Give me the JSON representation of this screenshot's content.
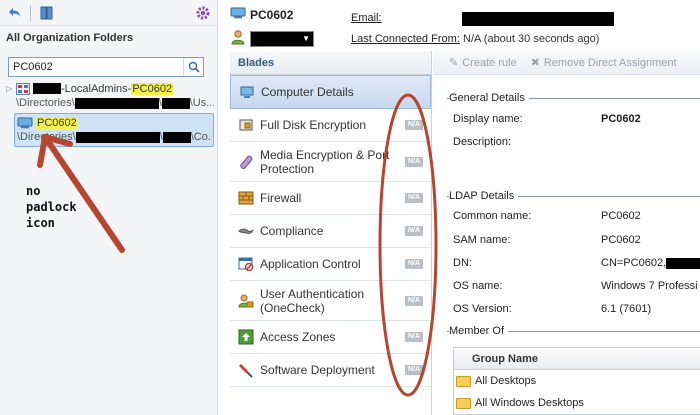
{
  "tree": {
    "title": "All Organization Folders",
    "search_value": "PC0602",
    "items": [
      {
        "row1_suffix": "-LocalAdmins-",
        "row1_hl": "PC0602",
        "row2_prefix": "\\Directories\\",
        "row2_mid": "\\",
        "row2_suffix": "\\Us..."
      },
      {
        "row1_hl": "PC0602",
        "row2_prefix": "\\Directories\\",
        "row2_mid": "\\",
        "row2_suffix": "\\Co..."
      }
    ]
  },
  "annotation": {
    "lines": [
      "no",
      "padlock",
      "icon"
    ]
  },
  "header": {
    "computer_name": "PC0602",
    "email_label": "Email:",
    "last_connected_label": "Last Connected From:",
    "last_connected_value": "N/A  (about 30 seconds ago)"
  },
  "blades": {
    "title": "Blades",
    "items": [
      {
        "label": "Computer Details",
        "active": true,
        "icon": "computer-details-icon"
      },
      {
        "label": "Full Disk Encryption",
        "na": "N/A",
        "icon": "disk-encryption-icon"
      },
      {
        "label": "Media Encryption & Port Protection",
        "na": "N/A",
        "icon": "media-encryption-icon"
      },
      {
        "label": "Firewall",
        "na": "N/A",
        "icon": "firewall-icon"
      },
      {
        "label": "Compliance",
        "na": "N/A",
        "icon": "compliance-icon"
      },
      {
        "label": "Application Control",
        "na": "N/A",
        "icon": "application-control-icon"
      },
      {
        "label": "User Authentication (OneCheck)",
        "na": "N/A",
        "icon": "user-authentication-icon"
      },
      {
        "label": "Access Zones",
        "na": "N/A",
        "icon": "access-zones-icon"
      },
      {
        "label": "Software Deployment",
        "na": "N/A",
        "icon": "software-deployment-icon"
      }
    ]
  },
  "details": {
    "toolbar": {
      "create_rule": "Create rule",
      "remove_assignment": "Remove Direct Assignment"
    },
    "general": {
      "title": "General Details",
      "display_name_label": "Display name:",
      "display_name_value": "PC0602",
      "description_label": "Description:"
    },
    "ldap": {
      "title": "LDAP Details",
      "common_name_label": "Common name:",
      "common_name_value": "PC0602",
      "sam_name_label": "SAM name:",
      "sam_name_value": "PC0602",
      "dn_label": "DN:",
      "dn_value": "CN=PC0602,",
      "os_name_label": "OS name:",
      "os_name_value": "Windows 7 Professi",
      "os_version_label": "OS Version:",
      "os_version_value": "6.1 (7601)"
    },
    "member_of": {
      "title": "Member Of",
      "column": "Group Name",
      "rows": [
        "All Desktops",
        "All Windows Desktops"
      ]
    }
  },
  "colors": {
    "annotation_red": "#b6462d",
    "highlight": "#f5f04a",
    "selected_bg": "#cfe3f7"
  }
}
